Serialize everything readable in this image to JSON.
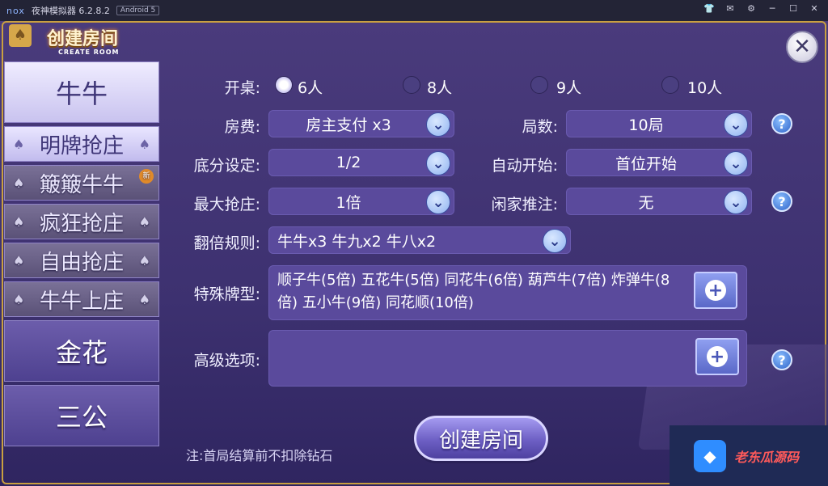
{
  "titlebar": {
    "logo": "nox",
    "title": "夜神模拟器 6.2.8.2",
    "android_badge": "Android 5",
    "icons": [
      "shirt-icon",
      "mail-icon",
      "gear-icon",
      "minimize-icon",
      "maximize-icon",
      "close-icon"
    ]
  },
  "brand": {
    "title_cn": "创建房间",
    "title_en": "CREATE ROOM"
  },
  "sidebar": {
    "items": [
      {
        "label": "牛牛",
        "type": "big",
        "active": true
      },
      {
        "label": "明牌抢庄",
        "type": "sub",
        "active": true
      },
      {
        "label": "簸簸牛牛",
        "type": "sub",
        "active": false,
        "badge": "新"
      },
      {
        "label": "疯狂抢庄",
        "type": "sub",
        "active": false
      },
      {
        "label": "自由抢庄",
        "type": "sub",
        "active": false
      },
      {
        "label": "牛牛上庄",
        "type": "sub",
        "active": false
      },
      {
        "label": "金花",
        "type": "big",
        "active": false
      },
      {
        "label": "三公",
        "type": "big",
        "active": false
      }
    ]
  },
  "form": {
    "table_label": "开桌:",
    "table_options": [
      {
        "label": "6人",
        "selected": true
      },
      {
        "label": "8人",
        "selected": false
      },
      {
        "label": "9人",
        "selected": false
      },
      {
        "label": "10人",
        "selected": false
      }
    ],
    "fee_label": "房费:",
    "fee_value": "房主支付 x3",
    "rounds_label": "局数:",
    "rounds_value": "10局",
    "base_label": "底分设定:",
    "base_value": "1/2",
    "autostart_label": "自动开始:",
    "autostart_value": "首位开始",
    "maxbank_label": "最大抢庄:",
    "maxbank_value": "1倍",
    "push_label": "闲家推注:",
    "push_value": "无",
    "double_label": "翻倍规则:",
    "double_value": "牛牛x3  牛九x2  牛八x2",
    "special_label": "特殊牌型:",
    "special_value": "顺子牛(5倍)  五花牛(5倍)  同花牛(6倍)  葫芦牛(7倍)  炸弹牛(8倍)  五小牛(9倍)  同花顺(10倍)",
    "advanced_label": "高级选项:",
    "advanced_value": ""
  },
  "create_button": "创建房间",
  "note": "注:首局结算前不扣除钻石",
  "close_symbol": "✕",
  "help_symbol": "?",
  "plus_symbol": "+",
  "chevron_symbol": "⌄",
  "watermark": "老东瓜源码",
  "colors": {
    "panel_bg": "#4a3b7c",
    "accent_gold": "#c9a040",
    "dropdown_bg": "#5a4a9c",
    "help_blue": "#2f63c9"
  }
}
